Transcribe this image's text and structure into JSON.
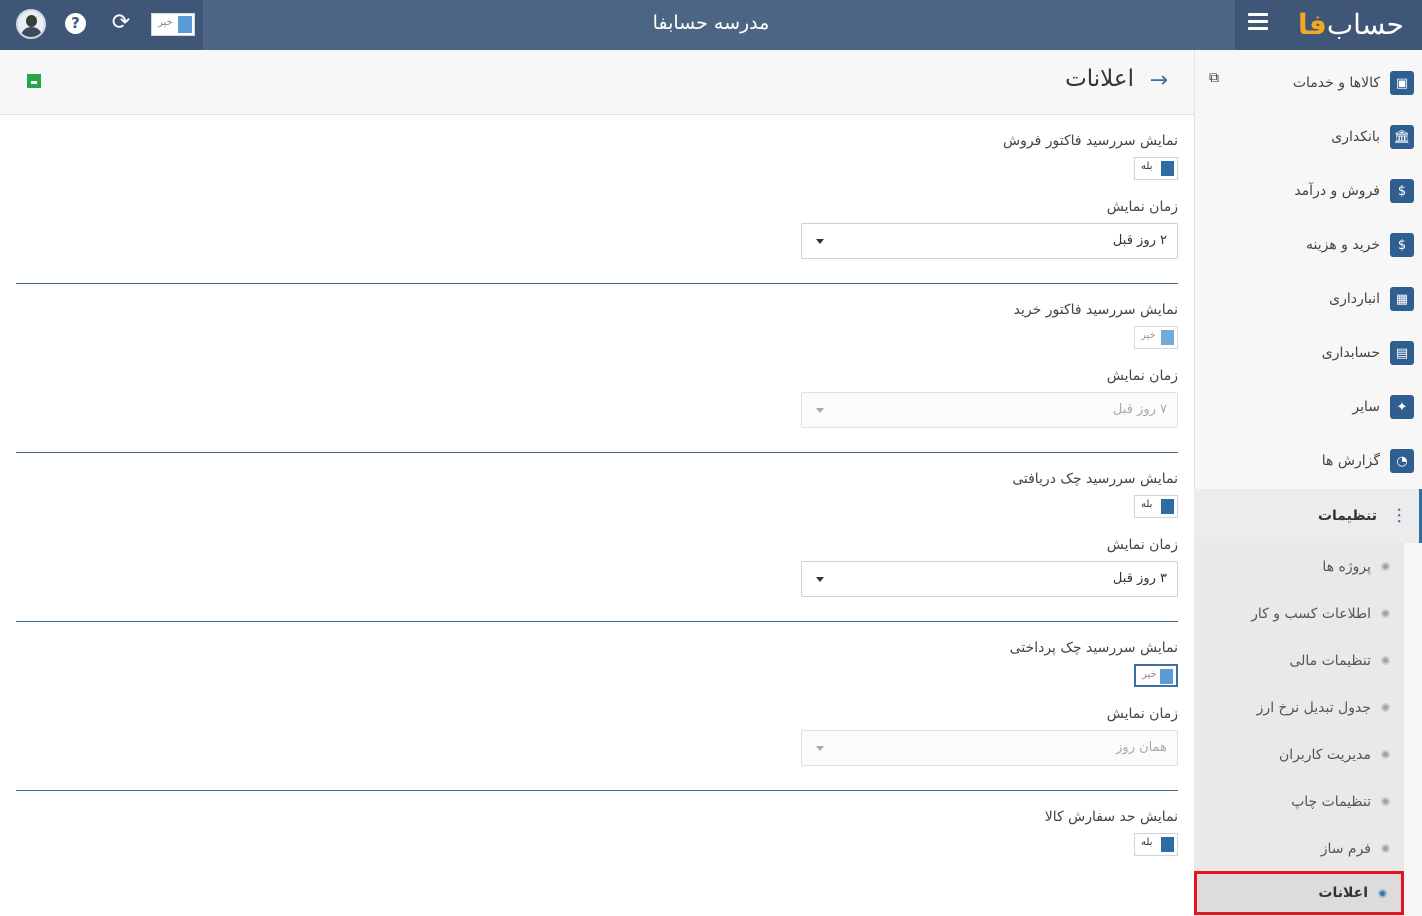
{
  "topbar": {
    "title": "مدرسه حسابفا",
    "logo_text": "حساب",
    "logo_accent": "فا",
    "toggle_label": "خیر",
    "help_glyph": "?",
    "refresh_glyph": "⟳"
  },
  "page": {
    "title": "اعلانات",
    "back_glyph": "→"
  },
  "sections": [
    {
      "label": "نمایش سررسید فاکتور فروش",
      "toggle": "بله",
      "time_label": "زمان نمایش",
      "select": "۲ روز قبل"
    },
    {
      "label": "نمایش سررسید فاکتور خرید",
      "toggle": "خیر",
      "time_label": "زمان نمایش",
      "select": "۷ روز قبل"
    },
    {
      "label": "نمایش سررسید چک دریافتی",
      "toggle": "بله",
      "time_label": "زمان نمایش",
      "select": "۳ روز قبل"
    },
    {
      "label": "نمایش سررسید چک پرداختی",
      "toggle": "خیر",
      "time_label": "زمان نمایش",
      "select": "همان روز"
    },
    {
      "label": "نمایش حد سفارش کالا",
      "toggle": "بله"
    }
  ],
  "sidebar": {
    "items": [
      {
        "label": "کالاها و خدمات",
        "icon": "box-icon",
        "glyph": "▣"
      },
      {
        "label": "بانکداری",
        "icon": "bank-icon",
        "glyph": "🏛"
      },
      {
        "label": "فروش و درآمد",
        "icon": "sales-icon",
        "glyph": "$"
      },
      {
        "label": "خرید و هزینه",
        "icon": "wallet-icon",
        "glyph": "$"
      },
      {
        "label": "انبارداری",
        "icon": "warehouse-icon",
        "glyph": "▦"
      },
      {
        "label": "حسابداری",
        "icon": "abacus-icon",
        "glyph": "▤"
      },
      {
        "label": "سایر",
        "icon": "tools-icon",
        "glyph": "✦"
      },
      {
        "label": "گزارش ها",
        "icon": "report-icon",
        "glyph": "◔"
      },
      {
        "label": "تنظیمات",
        "icon": "settings-sliders-icon",
        "glyph": "⫶"
      }
    ],
    "sub_items": [
      {
        "label": "پروژه ها"
      },
      {
        "label": "اطلاعات کسب و کار"
      },
      {
        "label": "تنظیمات مالی"
      },
      {
        "label": "جدول تبدیل نرخ ارز"
      },
      {
        "label": "مدیریت کاربران"
      },
      {
        "label": "تنظیمات چاپ"
      },
      {
        "label": "فرم ساز"
      },
      {
        "label": "اعلانات"
      }
    ]
  },
  "colors": {
    "topbar": "#4d6585",
    "accent": "#2e6da4",
    "highlight": "#e3161c",
    "save": "#2aa64a"
  }
}
